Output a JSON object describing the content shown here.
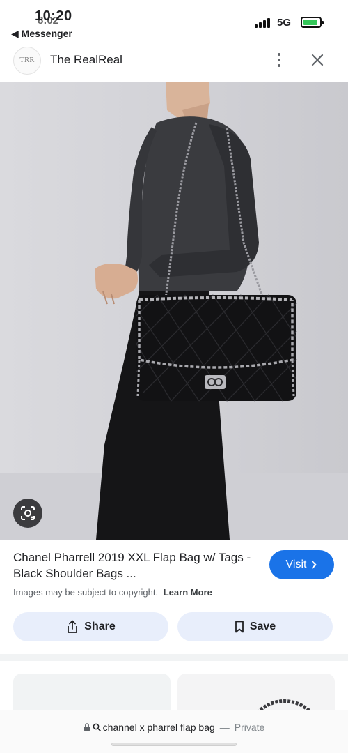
{
  "status_bar": {
    "time_primary": "10:20",
    "time_secondary": "8:02",
    "back_app": "◀ Messenger",
    "network": "5G"
  },
  "header": {
    "logo_text": "TRR",
    "site_name": "The RealReal"
  },
  "product": {
    "title": "Chanel Pharrell 2019 XXL Flap Bag w/ Tags - Black Shoulder Bags ...",
    "visit_label": "Visit",
    "copyright_text": "Images may be subject to copyright.",
    "learn_more_label": "Learn More",
    "share_label": "Share",
    "save_label": "Save"
  },
  "bottom_bar": {
    "query": "channel x pharrel flap bag",
    "separator": "—",
    "privacy": "Private"
  },
  "colors": {
    "accent": "#1a73e8",
    "pill_bg": "#e8eefb"
  }
}
